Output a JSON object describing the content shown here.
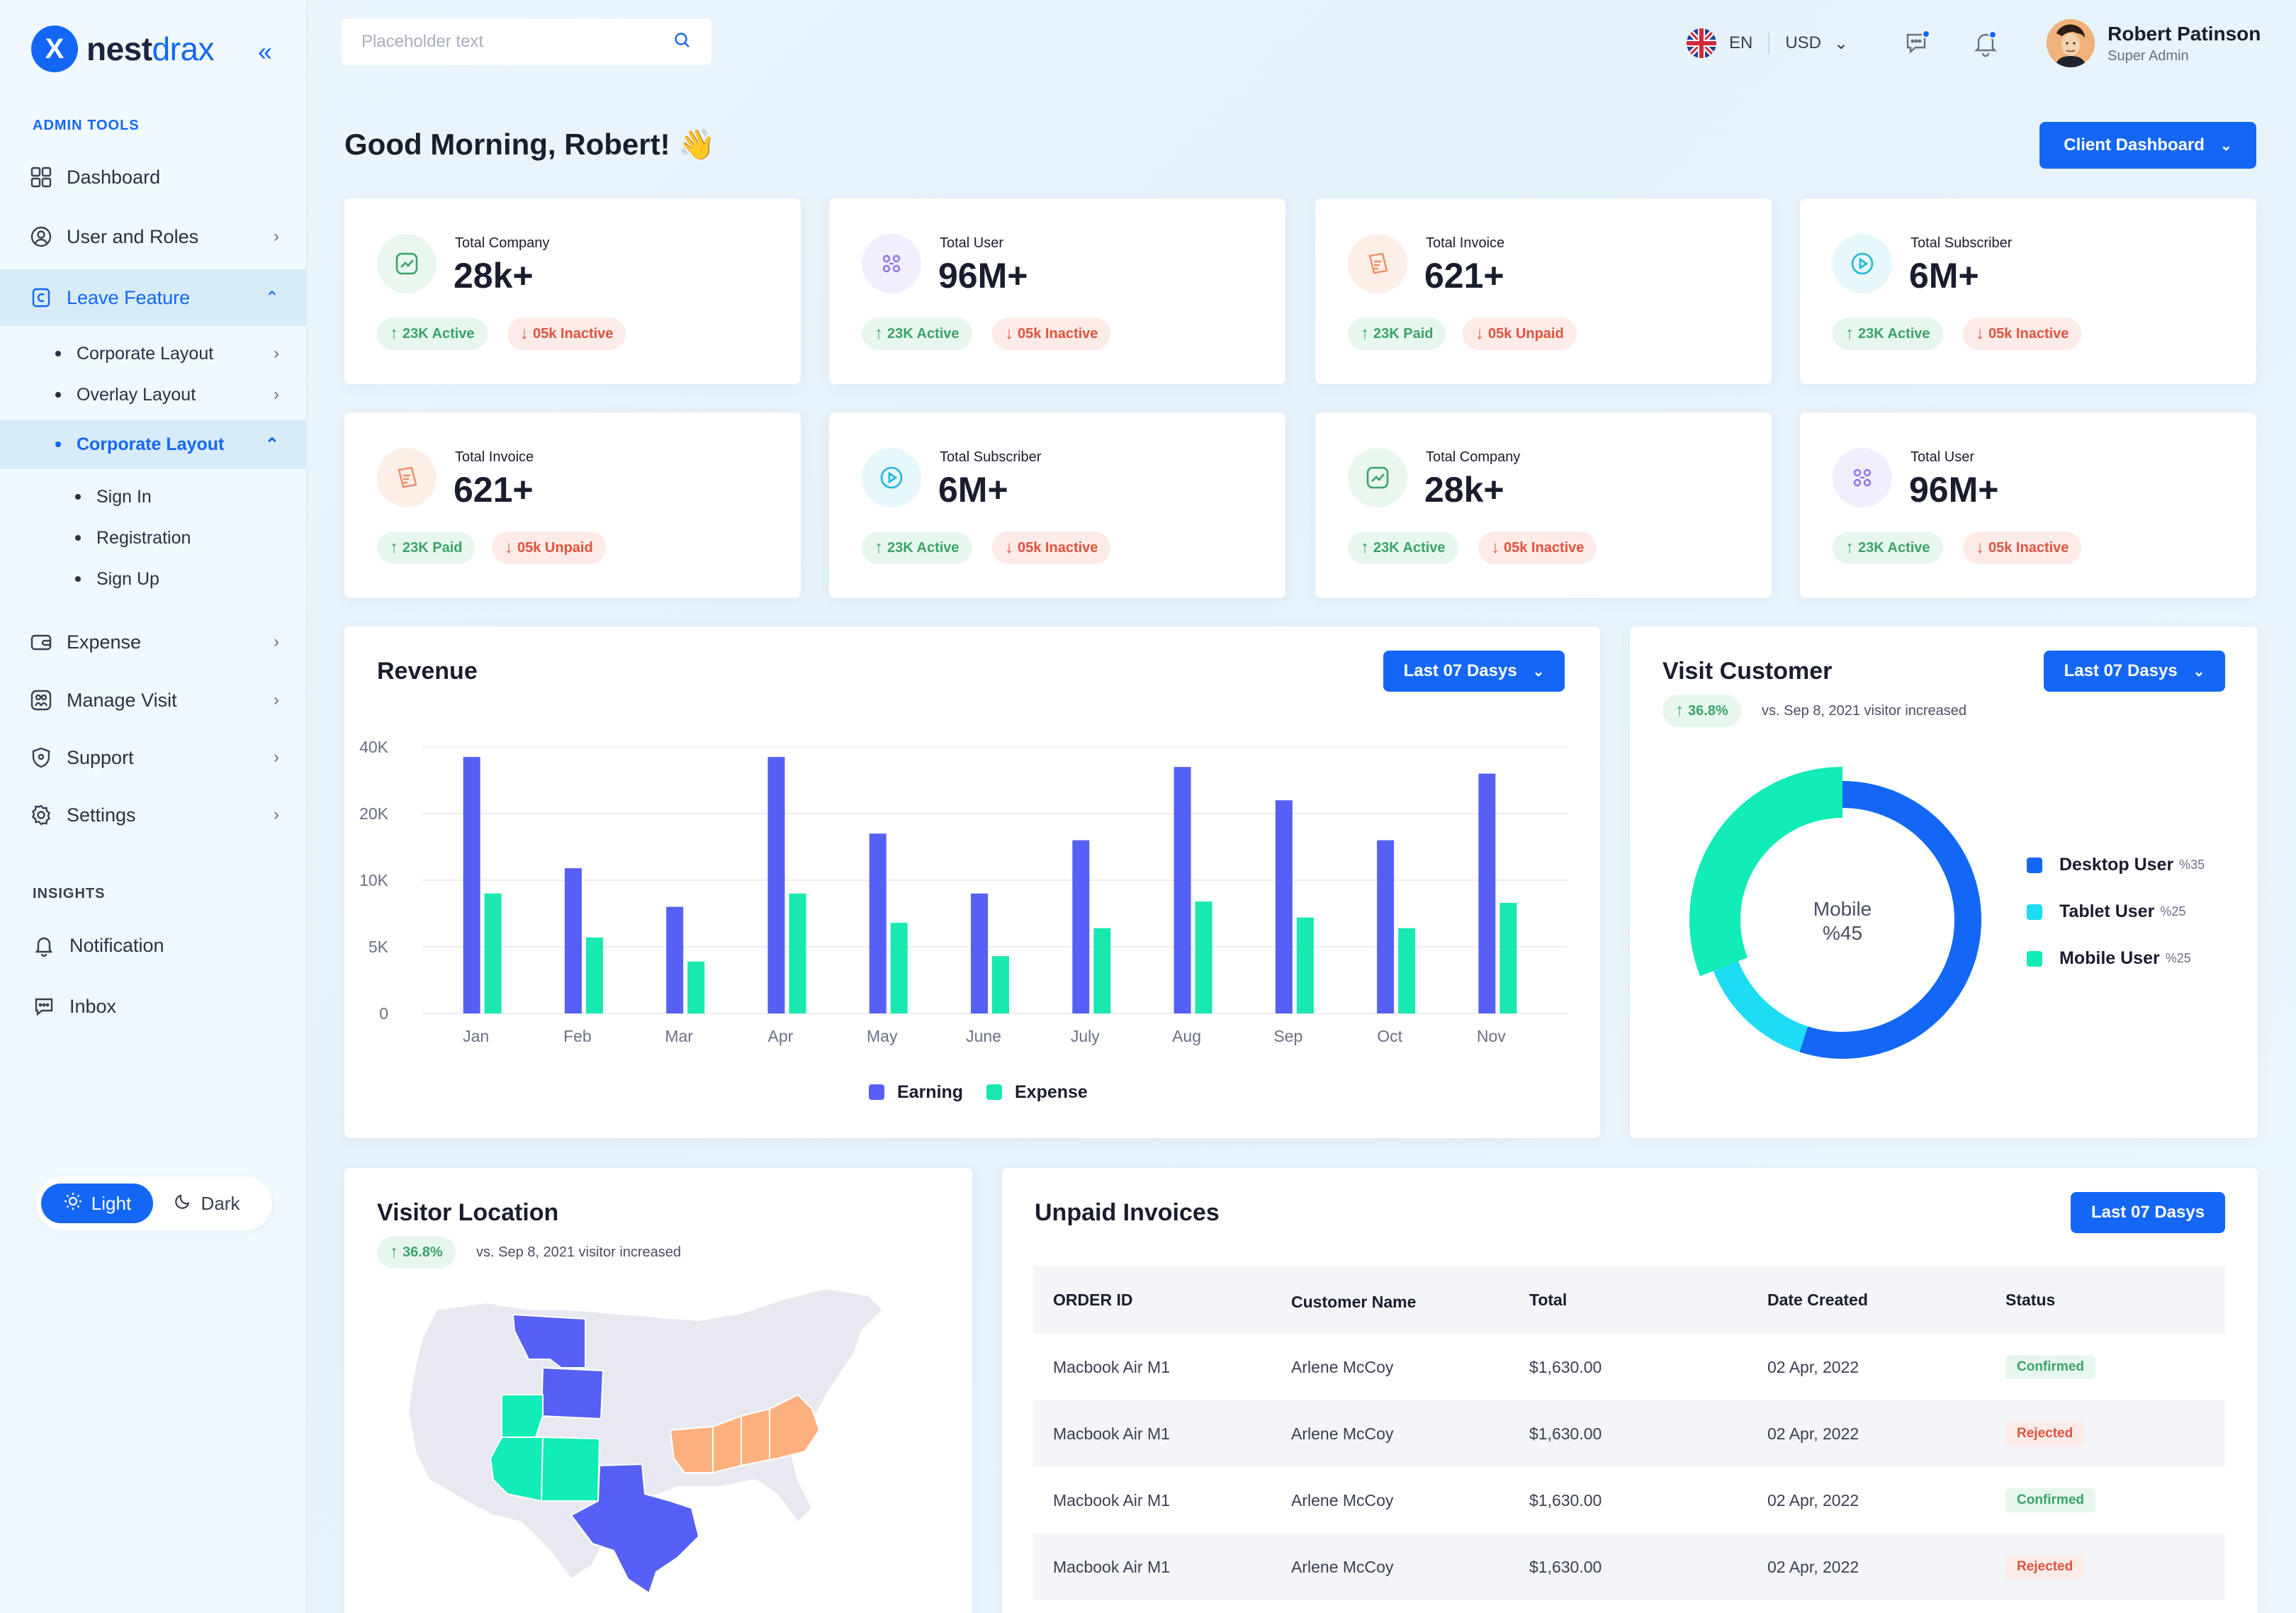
{
  "brand": {
    "name_bold": "nest",
    "name_light": "drax",
    "mark": "X"
  },
  "colors": {
    "primary": "#1467f5",
    "earning": "#5660f4",
    "expense": "#19e8b0",
    "desktop": "#1467f5",
    "tablet": "#1fdcf5",
    "mobile": "#12ecb6",
    "green": "#3aa367",
    "red": "#e0523c"
  },
  "sidebar": {
    "admin_tools_label": "ADMIN TOOLS",
    "insights_label": "INSIGHTS",
    "items": {
      "dashboard": "Dashboard",
      "user_roles": "User and Roles",
      "leave_feature": "Leave Feature",
      "corporate_layout_1": "Corporate Layout",
      "overlay_layout": "Overlay Layout",
      "corporate_layout_2": "Corporate Layout",
      "sign_in": "Sign In",
      "registration": "Registration",
      "sign_up": "Sign Up",
      "expense": "Expense",
      "manage_visit": "Manage Visit",
      "support": "Support",
      "settings": "Settings",
      "notification": "Notification",
      "inbox": "Inbox"
    },
    "theme": {
      "light": "Light",
      "dark": "Dark"
    }
  },
  "topbar": {
    "search_placeholder": "Placeholder text",
    "language": "EN",
    "currency": "USD",
    "user_name": "Robert Patinson",
    "user_role": "Super Admin"
  },
  "greeting": "Good Morning, Robert! 👋",
  "client_dashboard_label": "Client Dashboard",
  "stats": [
    {
      "label": "Total Company",
      "value": "28k+",
      "up": "23K Active",
      "down": "05k Inactive",
      "icon": "chart-icon"
    },
    {
      "label": "Total User",
      "value": "96M+",
      "up": "23K Active",
      "down": "05k Inactive",
      "icon": "users-icon"
    },
    {
      "label": "Total Invoice",
      "value": "621+",
      "up": "23K Paid",
      "down": "05k Unpaid",
      "icon": "invoice-icon"
    },
    {
      "label": "Total Subscriber",
      "value": "6M+",
      "up": "23K Active",
      "down": "05k Inactive",
      "icon": "play-icon"
    },
    {
      "label": "Total Invoice",
      "value": "621+",
      "up": "23K Paid",
      "down": "05k Unpaid",
      "icon": "invoice-icon"
    },
    {
      "label": "Total Subscriber",
      "value": "6M+",
      "up": "23K Active",
      "down": "05k Inactive",
      "icon": "play-icon"
    },
    {
      "label": "Total Company",
      "value": "28k+",
      "up": "23K Active",
      "down": "05k Inactive",
      "icon": "chart-icon"
    },
    {
      "label": "Total User",
      "value": "96M+",
      "up": "23K Active",
      "down": "05k Inactive",
      "icon": "users-icon"
    }
  ],
  "revenue": {
    "title": "Revenue",
    "period": "Last 07 Dasys",
    "legend": {
      "earning": "Earning",
      "expense": "Expense"
    }
  },
  "visit_customer": {
    "title": "Visit Customer",
    "period": "Last 07 Dasys",
    "change": "36.8%",
    "note": "vs. Sep 8, 2021 visitor increased",
    "center_label": "Mobile",
    "center_value": "%45",
    "legend": [
      {
        "name": "Desktop User",
        "pct": "%35"
      },
      {
        "name": "Tablet User",
        "pct": "%25"
      },
      {
        "name": "Mobile User",
        "pct": "%25"
      }
    ]
  },
  "visitor_location": {
    "title": "Visitor Location",
    "change": "36.8%",
    "note": "vs. Sep 8, 2021 visitor increased"
  },
  "invoices": {
    "title": "Unpaid Invoices",
    "period": "Last 07 Dasys",
    "headers": [
      "ORDER ID",
      "Customer Name",
      "Total",
      "Date Created",
      "Status"
    ],
    "rows": [
      [
        "Macbook Air M1",
        "Arlene McCoy",
        "$1,630.00",
        "02 Apr, 2022",
        "Confirmed"
      ],
      [
        "Macbook Air M1",
        "Arlene McCoy",
        "$1,630.00",
        "02 Apr, 2022",
        "Rejected"
      ],
      [
        "Macbook Air M1",
        "Arlene McCoy",
        "$1,630.00",
        "02 Apr, 2022",
        "Confirmed"
      ],
      [
        "Macbook Air M1",
        "Arlene McCoy",
        "$1,630.00",
        "02 Apr, 2022",
        "Rejected"
      ]
    ]
  },
  "chart_data": [
    {
      "type": "bar",
      "title": "Revenue",
      "categories": [
        "Jan",
        "Feb",
        "Mar",
        "Apr",
        "May",
        "June",
        "July",
        "Aug",
        "Sep",
        "Oct",
        "Nov"
      ],
      "ytick_labels": [
        "0",
        "5K",
        "10K",
        "20K",
        "40K"
      ],
      "series": [
        {
          "name": "Earning",
          "values": [
            37000,
            11800,
            8000,
            37000,
            17000,
            9000,
            16000,
            34000,
            24000,
            16000,
            32000
          ]
        },
        {
          "name": "Expense",
          "values": [
            9000,
            5700,
            3900,
            9000,
            6800,
            4300,
            6400,
            8400,
            7200,
            6400,
            8300
          ]
        }
      ],
      "ylim": [
        0,
        40000
      ],
      "grid": true,
      "legend": "bottom"
    },
    {
      "type": "pie",
      "title": "Visit Customer",
      "categories": [
        "Desktop User",
        "Tablet User",
        "Mobile User"
      ],
      "values": [
        55,
        14,
        31
      ],
      "legend": "right"
    }
  ]
}
